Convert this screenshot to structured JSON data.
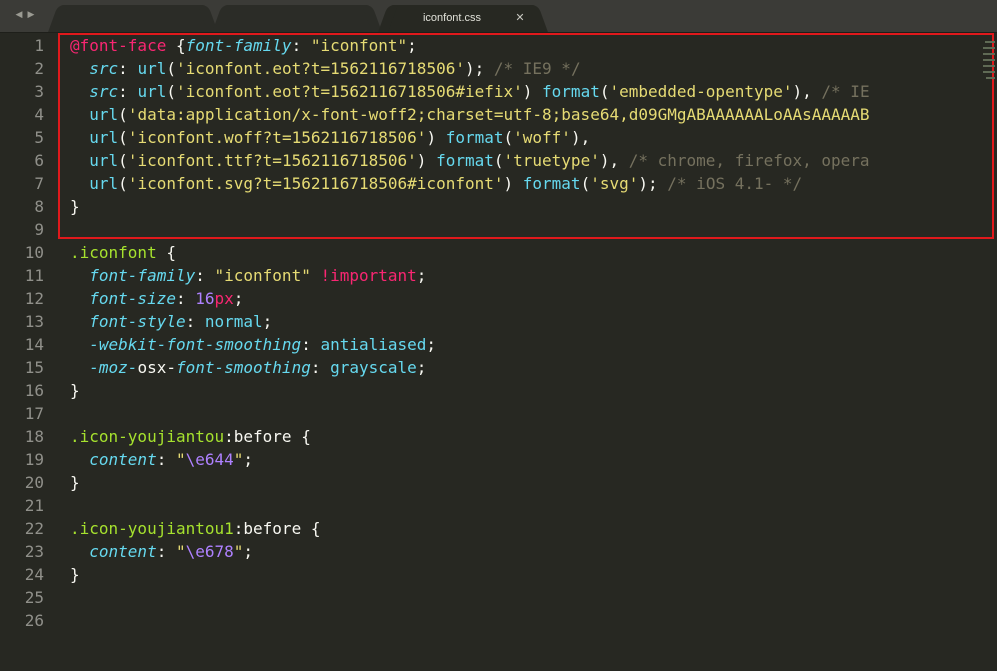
{
  "nav": {
    "back_icon": "◀",
    "forward_icon": "▶"
  },
  "tabs": [
    {
      "label": "",
      "active": false
    },
    {
      "label": "",
      "active": false
    },
    {
      "label": "iconfont.css",
      "active": true,
      "close_icon": "✕"
    }
  ],
  "line_numbers": [
    "1",
    "2",
    "3",
    "4",
    "5",
    "6",
    "7",
    "8",
    "9",
    "10",
    "11",
    "12",
    "13",
    "14",
    "15",
    "16",
    "17",
    "18",
    "19",
    "20",
    "21",
    "22",
    "23",
    "24",
    "25",
    "26"
  ],
  "code_lines": [
    [
      [
        "t-at",
        "@font-face"
      ],
      [
        "t-punc",
        " {"
      ],
      [
        "t-prop",
        "font-family"
      ],
      [
        "t-punc",
        ": "
      ],
      [
        "t-str",
        "\"iconfont\""
      ],
      [
        "t-punc",
        ";"
      ]
    ],
    [
      [
        "t-plain",
        "  "
      ],
      [
        "t-prop",
        "src"
      ],
      [
        "t-punc",
        ": "
      ],
      [
        "t-fn",
        "url"
      ],
      [
        "t-punc",
        "("
      ],
      [
        "t-str",
        "'iconfont.eot?t=1562116718506'"
      ],
      [
        "t-punc",
        "); "
      ],
      [
        "t-com",
        "/* IE9 */"
      ]
    ],
    [
      [
        "t-plain",
        "  "
      ],
      [
        "t-prop",
        "src"
      ],
      [
        "t-punc",
        ": "
      ],
      [
        "t-fn",
        "url"
      ],
      [
        "t-punc",
        "("
      ],
      [
        "t-str",
        "'iconfont.eot?t=1562116718506#iefix'"
      ],
      [
        "t-punc",
        ") "
      ],
      [
        "t-fn",
        "format"
      ],
      [
        "t-punc",
        "("
      ],
      [
        "t-str",
        "'embedded-opentype'"
      ],
      [
        "t-punc",
        "), "
      ],
      [
        "t-com",
        "/* IE"
      ]
    ],
    [
      [
        "t-plain",
        "  "
      ],
      [
        "t-fn",
        "url"
      ],
      [
        "t-punc",
        "("
      ],
      [
        "t-str",
        "'data:application/x-font-woff2;charset=utf-8;base64,d09GMgABAAAAAALoAAsAAAAAB"
      ]
    ],
    [
      [
        "t-plain",
        "  "
      ],
      [
        "t-fn",
        "url"
      ],
      [
        "t-punc",
        "("
      ],
      [
        "t-str",
        "'iconfont.woff?t=1562116718506'"
      ],
      [
        "t-punc",
        ") "
      ],
      [
        "t-fn",
        "format"
      ],
      [
        "t-punc",
        "("
      ],
      [
        "t-str",
        "'woff'"
      ],
      [
        "t-punc",
        "),"
      ]
    ],
    [
      [
        "t-plain",
        "  "
      ],
      [
        "t-fn",
        "url"
      ],
      [
        "t-punc",
        "("
      ],
      [
        "t-str",
        "'iconfont.ttf?t=1562116718506'"
      ],
      [
        "t-punc",
        ") "
      ],
      [
        "t-fn",
        "format"
      ],
      [
        "t-punc",
        "("
      ],
      [
        "t-str",
        "'truetype'"
      ],
      [
        "t-punc",
        "), "
      ],
      [
        "t-com",
        "/* chrome, firefox, opera"
      ]
    ],
    [
      [
        "t-plain",
        "  "
      ],
      [
        "t-fn",
        "url"
      ],
      [
        "t-punc",
        "("
      ],
      [
        "t-str",
        "'iconfont.svg?t=1562116718506#iconfont'"
      ],
      [
        "t-punc",
        ") "
      ],
      [
        "t-fn",
        "format"
      ],
      [
        "t-punc",
        "("
      ],
      [
        "t-str",
        "'svg'"
      ],
      [
        "t-punc",
        "); "
      ],
      [
        "t-com",
        "/* iOS 4.1- */"
      ]
    ],
    [
      [
        "t-punc",
        "}"
      ]
    ],
    [],
    [
      [
        "t-sel",
        ".iconfont"
      ],
      [
        "t-punc",
        " {"
      ]
    ],
    [
      [
        "t-plain",
        "  "
      ],
      [
        "t-prop",
        "font-family"
      ],
      [
        "t-punc",
        ": "
      ],
      [
        "t-str",
        "\"iconfont\""
      ],
      [
        "t-punc",
        " "
      ],
      [
        "t-imp",
        "!important"
      ],
      [
        "t-punc",
        ";"
      ]
    ],
    [
      [
        "t-plain",
        "  "
      ],
      [
        "t-prop",
        "font-size"
      ],
      [
        "t-punc",
        ": "
      ],
      [
        "t-num",
        "16"
      ],
      [
        "t-unit",
        "px"
      ],
      [
        "t-punc",
        ";"
      ]
    ],
    [
      [
        "t-plain",
        "  "
      ],
      [
        "t-prop",
        "font-style"
      ],
      [
        "t-punc",
        ": "
      ],
      [
        "t-val",
        "normal"
      ],
      [
        "t-punc",
        ";"
      ]
    ],
    [
      [
        "t-plain",
        "  "
      ],
      [
        "t-prop",
        "-webkit-font-smoothing"
      ],
      [
        "t-punc",
        ": "
      ],
      [
        "t-val",
        "antialiased"
      ],
      [
        "t-punc",
        ";"
      ]
    ],
    [
      [
        "t-plain",
        "  "
      ],
      [
        "t-prop",
        "-moz-"
      ],
      [
        "t-plain",
        "osx-"
      ],
      [
        "t-prop",
        "font-smoothing"
      ],
      [
        "t-punc",
        ": "
      ],
      [
        "t-val",
        "grayscale"
      ],
      [
        "t-punc",
        ";"
      ]
    ],
    [
      [
        "t-punc",
        "}"
      ]
    ],
    [],
    [
      [
        "t-sel",
        ".icon-youjiantou"
      ],
      [
        "t-plain",
        ":before"
      ],
      [
        "t-punc",
        " {"
      ]
    ],
    [
      [
        "t-plain",
        "  "
      ],
      [
        "t-prop",
        "content"
      ],
      [
        "t-punc",
        ": "
      ],
      [
        "t-str",
        "\""
      ],
      [
        "t-escape",
        "\\e644"
      ],
      [
        "t-str",
        "\""
      ],
      [
        "t-punc",
        ";"
      ]
    ],
    [
      [
        "t-punc",
        "}"
      ]
    ],
    [],
    [
      [
        "t-sel",
        ".icon-youjiantou1"
      ],
      [
        "t-plain",
        ":before"
      ],
      [
        "t-punc",
        " {"
      ]
    ],
    [
      [
        "t-plain",
        "  "
      ],
      [
        "t-prop",
        "content"
      ],
      [
        "t-punc",
        ": "
      ],
      [
        "t-str",
        "\""
      ],
      [
        "t-escape",
        "\\e678"
      ],
      [
        "t-str",
        "\""
      ],
      [
        "t-punc",
        ";"
      ]
    ],
    [
      [
        "t-punc",
        "}"
      ]
    ],
    [],
    []
  ],
  "colors": {
    "background": "#272822",
    "highlight_border": "#e0191c",
    "line_number": "#90908a"
  },
  "icons": {
    "back": "triangle-left-icon",
    "forward": "triangle-right-icon",
    "close": "close-icon"
  }
}
